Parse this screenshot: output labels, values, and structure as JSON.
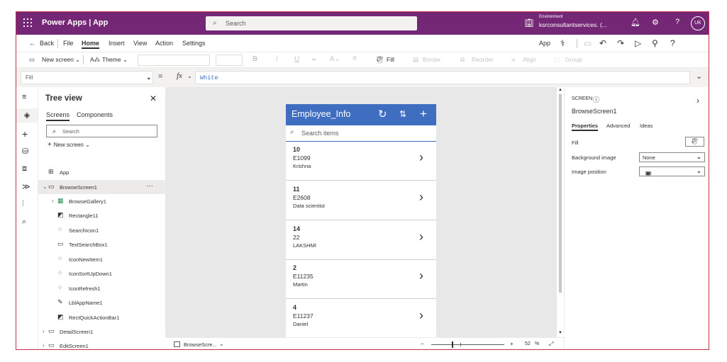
{
  "topbar": {
    "app_title": "Power Apps  |  App",
    "search_placeholder": "Search",
    "environment_label": "Environment",
    "environment_value": "ksrconsultantservices. (...",
    "bell": "🔔︎",
    "gear": "⚙",
    "help": "?",
    "avatar": "UK"
  },
  "menubar": {
    "back": "Back",
    "items": [
      "File",
      "Home",
      "Insert",
      "View",
      "Action",
      "Settings"
    ],
    "active": "Home",
    "app_label": "App"
  },
  "ribbon": {
    "new_screen": "New screen",
    "theme": "Theme",
    "bold": "B",
    "italic": "/",
    "underline": "U",
    "fill": "Fill",
    "border": "Border",
    "reorder": "Reorder",
    "align": "Align",
    "group": "Group"
  },
  "formula": {
    "property": "Fill",
    "equals": "=",
    "fx": "fx",
    "value": "White"
  },
  "tree": {
    "title": "Tree view",
    "tabs": [
      "Screens",
      "Components"
    ],
    "search_placeholder": "Search",
    "new_screen": "New screen",
    "nodes": [
      {
        "label": "App"
      },
      {
        "label": "BrowseScreen1"
      },
      {
        "label": "BrowseGallery1"
      },
      {
        "label": "Rectangle11"
      },
      {
        "label": "SearchIcon1"
      },
      {
        "label": "TextSearchBox1"
      },
      {
        "label": "IconNewItem1"
      },
      {
        "label": "IconSortUpDown1"
      },
      {
        "label": "IconRefresh1"
      },
      {
        "label": "LblAppName1"
      },
      {
        "label": "RectQuickActionBar1"
      },
      {
        "label": "DetailScreen1"
      },
      {
        "label": "EditScreen1"
      }
    ]
  },
  "app": {
    "title": "Employee_Info",
    "search_placeholder": "Search items",
    "records": [
      {
        "id": "10",
        "code": "E1099",
        "name": "Krishna"
      },
      {
        "id": "11",
        "code": "E2608",
        "name": "Data scientist"
      },
      {
        "id": "14",
        "code": "22",
        "name": "LAKSHMI"
      },
      {
        "id": "2",
        "code": "E11235",
        "name": "Martin"
      },
      {
        "id": "4",
        "code": "E11237",
        "name": "Daniel"
      }
    ]
  },
  "statusbar": {
    "screen": "BrowseScre...",
    "minus": "−",
    "plus": "+",
    "zoom": "52",
    "percent": "%"
  },
  "properties": {
    "kind": "SCREEN",
    "name": "BrowseScreen1",
    "tabs": [
      "Properties",
      "Advanced",
      "Ideas"
    ],
    "fill_label": "Fill",
    "bg_image_label": "Background image",
    "bg_image_value": "None",
    "image_position_label": "Image position",
    "image_position_value": "Fit"
  }
}
